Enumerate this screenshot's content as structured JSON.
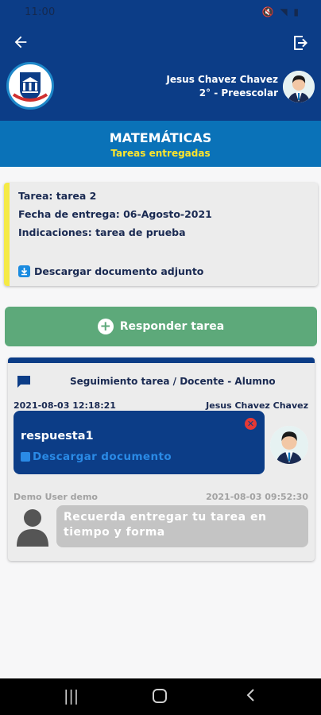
{
  "status_bar": {
    "time": "11:00",
    "icons": "🔇 ⁠ ▾▮"
  },
  "header": {
    "user_name": "Jesus Chavez Chavez",
    "user_grade": "2° - Preescolar"
  },
  "subject": {
    "title": "MATEMÁTICAS",
    "subtitle": "Tareas entregadas"
  },
  "task": {
    "name_line": "Tarea: tarea 2",
    "date_line": "Fecha de entrega: 06-Agosto-2021",
    "instructions_line": "Indicaciones: tarea de prueba",
    "download_label": "Descargar documento adjunto"
  },
  "respond_button": {
    "label": "Responder tarea"
  },
  "followup": {
    "title": "Seguimiento tarea / Docente - Alumno",
    "teacher_message": {
      "timestamp": "2021-08-03 12:18:21",
      "author": "Jesus Chavez Chavez",
      "text": "respuesta1",
      "download_label": "Descargar documento"
    },
    "student_message": {
      "author": "Demo User demo",
      "timestamp": "2021-08-03 09:52:30",
      "text": "Recuerda entregar tu tarea en tiempo y forma"
    }
  },
  "colors": {
    "primary": "#0c3d87",
    "accent": "#0a72b8",
    "success": "#5da97a",
    "highlight": "#ffe52b"
  }
}
